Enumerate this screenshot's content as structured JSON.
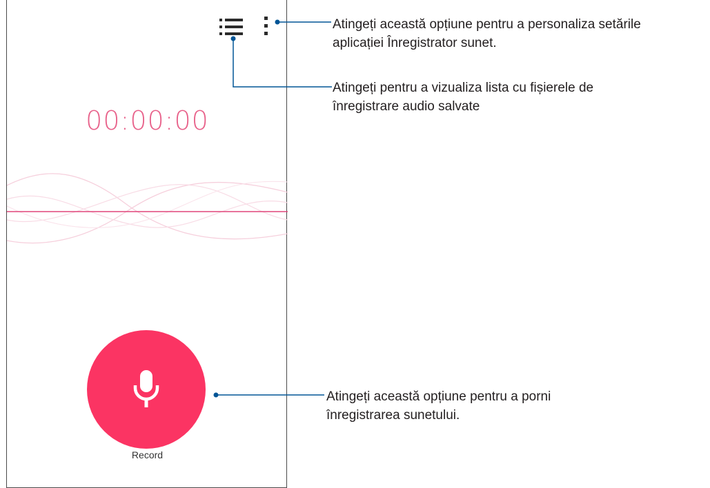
{
  "app": {
    "timer": "00:00:00",
    "record_label": "Record",
    "accent_color": "#fb3463",
    "timer_color": "#e8618a"
  },
  "toolbar": {
    "list_icon": "list-icon",
    "more_icon": "more-vert-icon"
  },
  "record_button": {
    "icon": "microphone-icon"
  },
  "callouts": [
    {
      "line1": "Atingeți această opțiune pentru a personaliza setările",
      "line2": "aplicației Înregistrator sunet."
    },
    {
      "line1": "Atingeți pentru a vizualiza lista cu fișierele de",
      "line2": "înregistrare audio salvate"
    },
    {
      "line1": "Atingeți această opțiune pentru a porni",
      "line2": "înregistrarea sunetului."
    }
  ],
  "callout_line_color": "#005596"
}
